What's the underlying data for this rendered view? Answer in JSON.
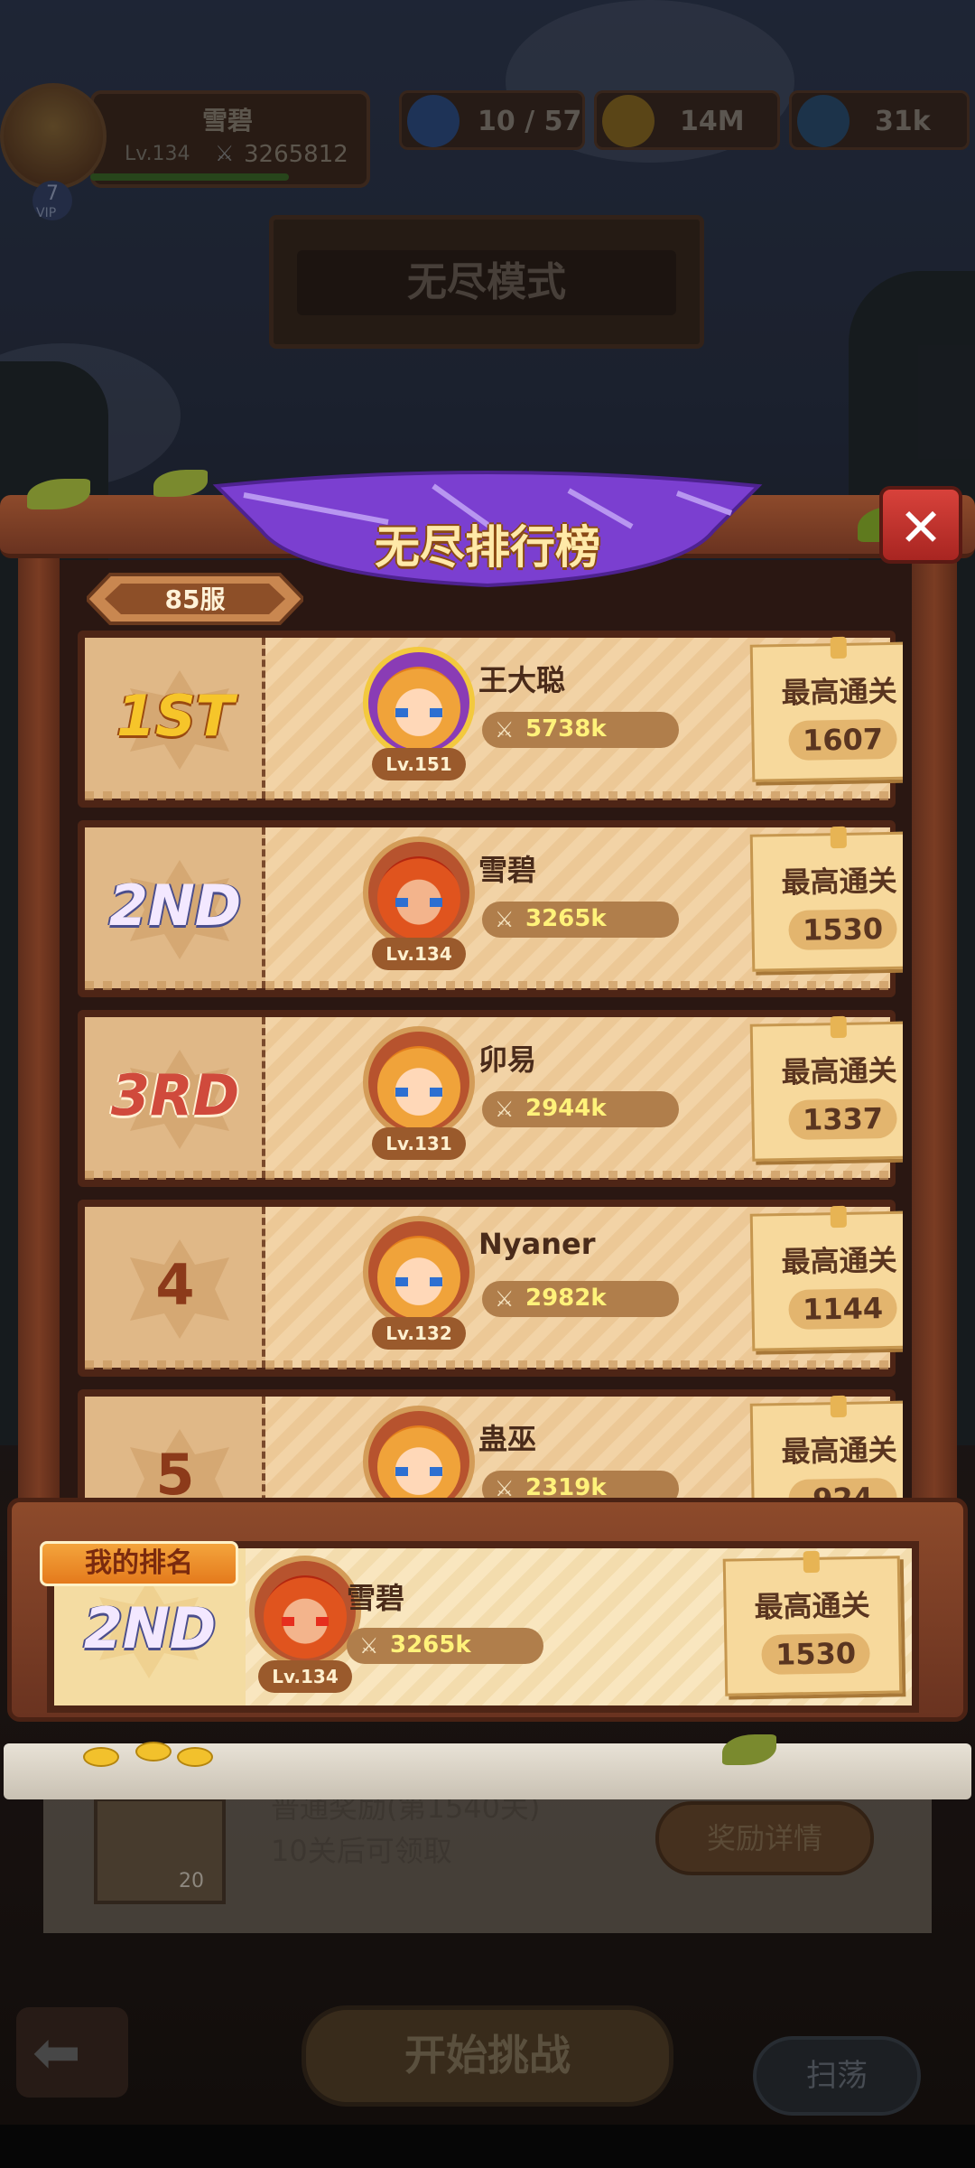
{
  "hud": {
    "player_name": "雪碧",
    "player_level": "Lv.134",
    "player_power": "3265812",
    "vip_level": "7",
    "vip_label": "VIP",
    "stars": "10 / 57",
    "gold": "14M",
    "gems": "31k"
  },
  "background": {
    "mode_title": "无尽模式",
    "reward_text_1": "普通奖励(第1540关)",
    "reward_text_2": "10关后可领取",
    "reward_details_button": "奖励详情",
    "item_count": "20",
    "start_button": "开始挑战",
    "sweep_button": "扫荡"
  },
  "leaderboard": {
    "title": "无尽排行榜",
    "server": "85服",
    "stage_label": "最高通关",
    "rows": [
      {
        "rank": "1ST",
        "name": "王大聪",
        "level": "Lv.151",
        "power": "5738k",
        "stage": "1607"
      },
      {
        "rank": "2ND",
        "name": "雪碧",
        "level": "Lv.134",
        "power": "3265k",
        "stage": "1530"
      },
      {
        "rank": "3RD",
        "name": "卯易",
        "level": "Lv.131",
        "power": "2944k",
        "stage": "1337"
      },
      {
        "rank": "4",
        "name": "Nyaner",
        "level": "Lv.132",
        "power": "2982k",
        "stage": "1144"
      },
      {
        "rank": "5",
        "name": "蛊巫",
        "level": "",
        "power": "2319k",
        "stage": "924"
      }
    ],
    "my_rank": {
      "tag": "我的排名",
      "rank": "2ND",
      "name": "雪碧",
      "level": "Lv.134",
      "power": "3265k",
      "stage": "1530"
    }
  },
  "colors": {
    "gold_rank": "#f6c52a",
    "silver_rank": "#f3e8ff",
    "bronze_rank": "#d04a3c",
    "banner_purple": "#7b3fd0",
    "close_red": "#d8423b"
  }
}
